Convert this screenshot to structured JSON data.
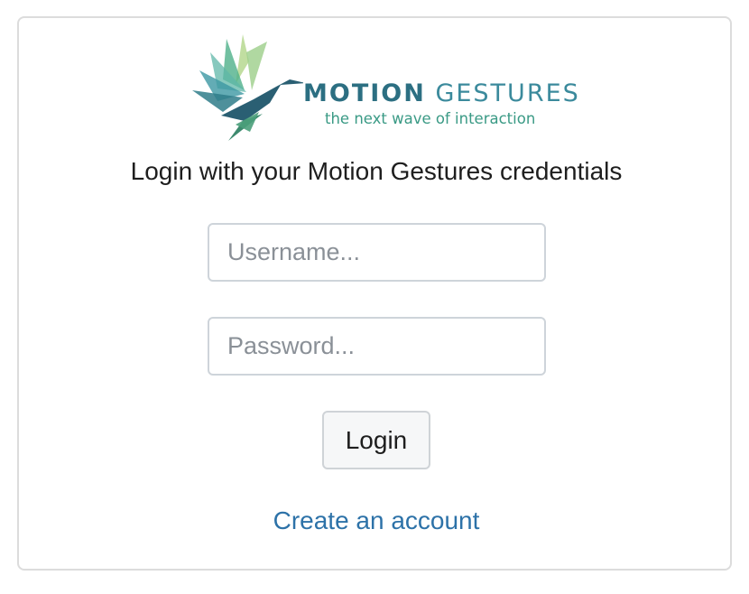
{
  "logo": {
    "icon": "hummingbird-icon",
    "brand_word1": "MOTION",
    "brand_word2": "GESTURES",
    "tagline": "the next wave of interaction",
    "colors": {
      "dark_teal": "#2c6f82",
      "teal": "#3b8a9c",
      "green": "#3a9a85",
      "light_green": "#b6d890"
    }
  },
  "heading": "Login with your Motion Gestures credentials",
  "username": {
    "placeholder": "Username...",
    "value": ""
  },
  "password": {
    "placeholder": "Password...",
    "value": ""
  },
  "login_button": "Login",
  "create_account_link": "Create an account",
  "colors": {
    "link": "#2d72a8",
    "border": "#ced4da"
  }
}
